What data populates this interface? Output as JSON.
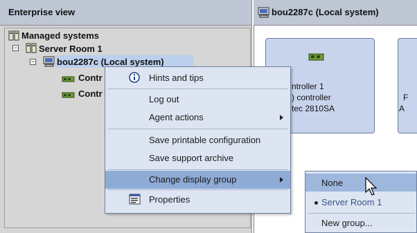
{
  "left_panel": {
    "header": "Enterprise view",
    "tree": {
      "root": "Managed systems",
      "group": "Server Room 1",
      "system": "bou2287c (Local system)",
      "controllers": [
        "Contr",
        "Contr"
      ]
    }
  },
  "right_panel": {
    "header": "bou2287c (Local system)",
    "card": {
      "line1": "ntroller 1",
      "line2": ") controller",
      "line3": "tec 2810SA"
    },
    "card2": {
      "line2": "F",
      "line3": "A"
    }
  },
  "context_menu": {
    "items": [
      {
        "label": "Hints and tips",
        "icon": "info-icon"
      },
      {
        "label": "Log out"
      },
      {
        "label": "Agent actions",
        "submenu": true
      },
      {
        "label": "Save printable configuration"
      },
      {
        "label": "Save support archive"
      },
      {
        "label": "Change display group",
        "submenu": true,
        "active": true
      },
      {
        "label": "Properties",
        "icon": "properties-icon"
      }
    ]
  },
  "submenu": {
    "items": [
      {
        "label": "None",
        "active": true
      },
      {
        "label": "Server Room 1",
        "selected": true
      },
      {
        "label": "New group..."
      }
    ]
  },
  "colors": {
    "header_bg": "#bfc6d4",
    "menu_bg": "#dde5f3",
    "menu_active": "#8eabd6",
    "card_bg": "#c8d4ec"
  }
}
